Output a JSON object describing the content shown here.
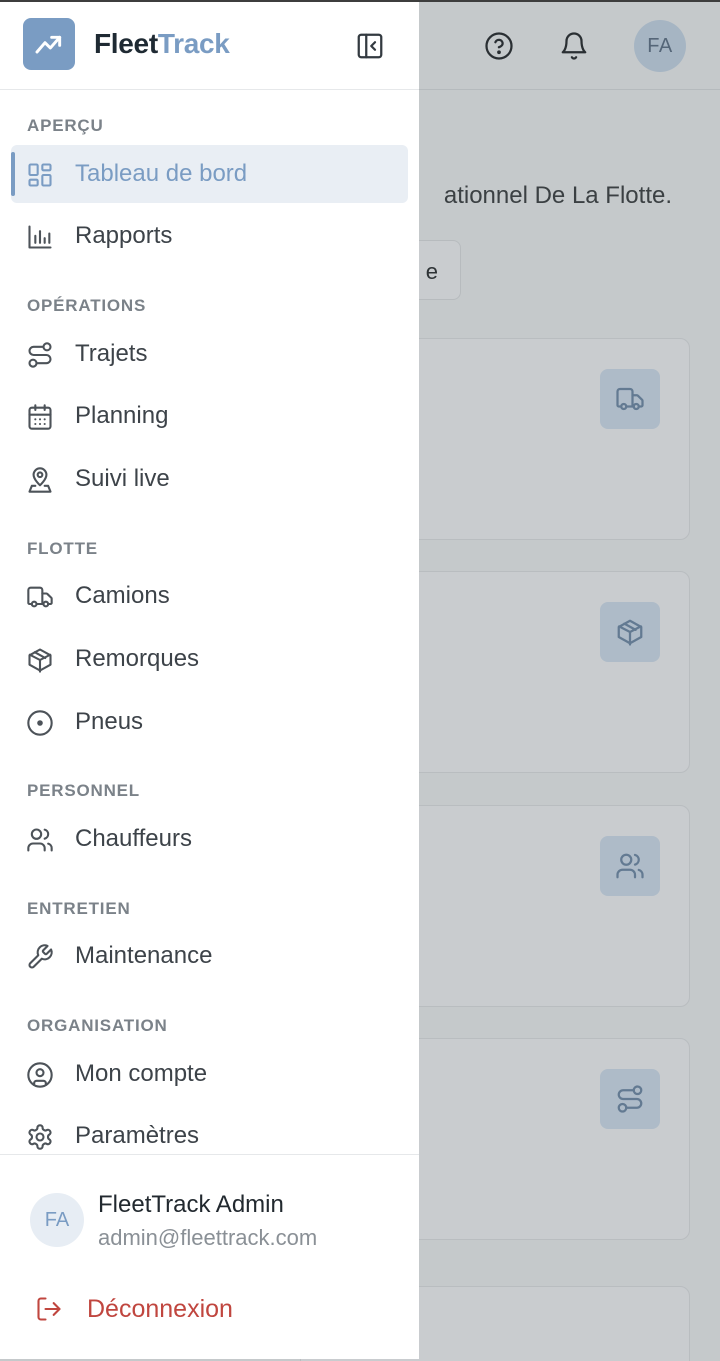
{
  "app": {
    "brand_part1": "Fleet",
    "brand_part2": "Track",
    "accent_color": "#7a9cc3",
    "danger_color": "#c0463f"
  },
  "header": {
    "avatar_initials": "FA",
    "help_icon": "help-circle-icon",
    "notifications_icon": "bell-icon"
  },
  "background": {
    "subtitle_fragment": "ationnel De La Flotte.",
    "button_fragment": "e",
    "card_icons": [
      "truck-icon",
      "package-icon",
      "users-icon",
      "route-icon"
    ]
  },
  "sidebar": {
    "sections": [
      {
        "title": "APERÇU",
        "items": [
          {
            "label": "Tableau de bord",
            "icon": "dashboard-grid-icon",
            "active": true
          },
          {
            "label": "Rapports",
            "icon": "bar-chart-icon",
            "active": false
          }
        ]
      },
      {
        "title": "OPÉRATIONS",
        "items": [
          {
            "label": "Trajets",
            "icon": "route-icon"
          },
          {
            "label": "Planning",
            "icon": "calendar-icon"
          },
          {
            "label": "Suivi live",
            "icon": "map-pin-user-icon"
          }
        ]
      },
      {
        "title": "FLOTTE",
        "items": [
          {
            "label": "Camions",
            "icon": "truck-icon"
          },
          {
            "label": "Remorques",
            "icon": "package-icon"
          },
          {
            "label": "Pneus",
            "icon": "tire-icon"
          }
        ]
      },
      {
        "title": "PERSONNEL",
        "items": [
          {
            "label": "Chauffeurs",
            "icon": "users-icon"
          }
        ]
      },
      {
        "title": "ENTRETIEN",
        "items": [
          {
            "label": "Maintenance",
            "icon": "wrench-icon"
          }
        ]
      },
      {
        "title": "ORGANISATION",
        "items": [
          {
            "label": "Mon compte",
            "icon": "user-circle-icon"
          },
          {
            "label": "Paramètres",
            "icon": "gear-icon"
          }
        ]
      }
    ]
  },
  "user": {
    "initials": "FA",
    "name": "FleetTrack Admin",
    "email": "admin@fleettrack.com"
  },
  "logout": {
    "label": "Déconnexion",
    "icon": "logout-icon"
  }
}
